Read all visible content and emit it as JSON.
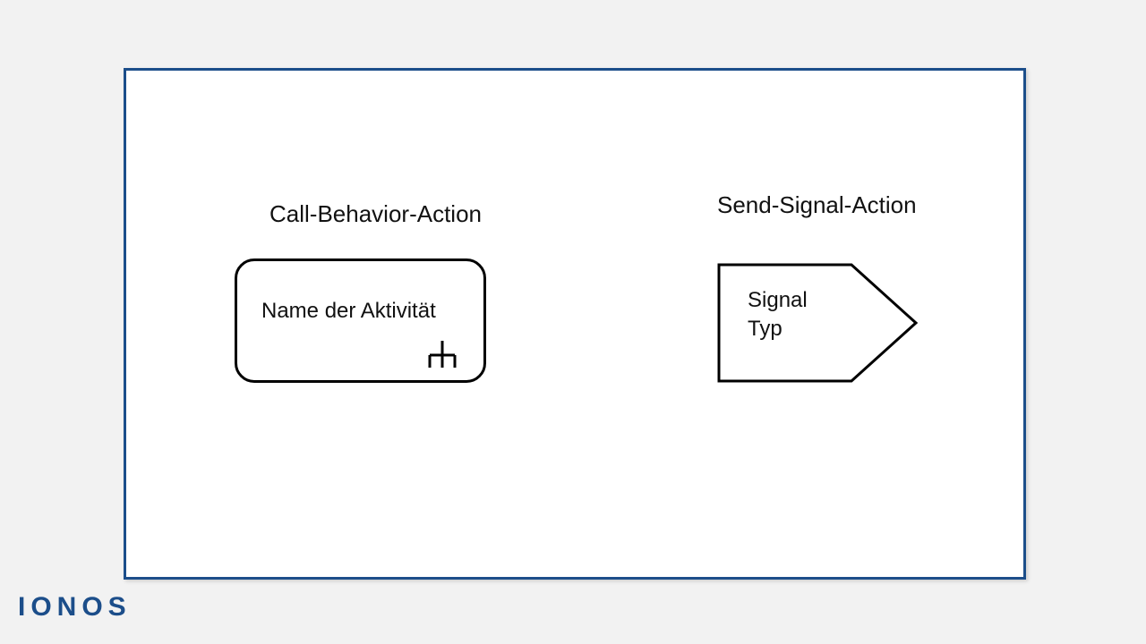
{
  "diagram": {
    "left": {
      "title": "Call-Behavior-Action",
      "box_label": "Name der Aktivität"
    },
    "right": {
      "title": "Send-Signal-Action",
      "signal_line1": "Signal",
      "signal_line2": "Typ"
    }
  },
  "brand": "IONOS"
}
